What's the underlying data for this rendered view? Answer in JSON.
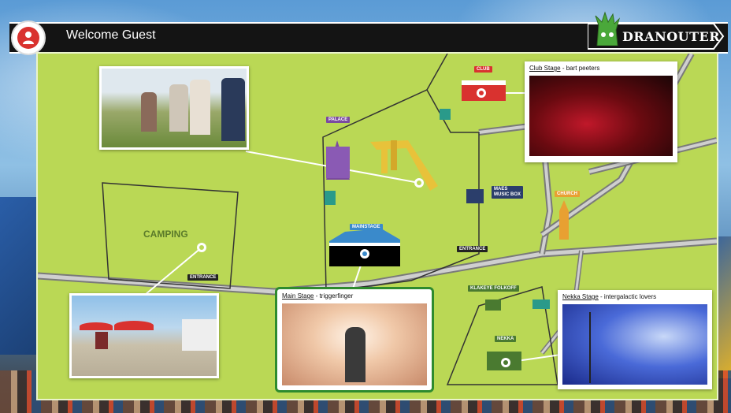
{
  "header": {
    "welcome": "Welcome Guest",
    "logo": "DRANOUTER"
  },
  "icons": {
    "user": "user-icon",
    "logo_mascot": "mascot-icon"
  },
  "colors": {
    "map_green": "#bad855",
    "road_gray": "#808080",
    "accent_red": "#d9322f",
    "highlight_green": "#2e8b2e"
  },
  "map": {
    "labels": {
      "camping": "CAMPING",
      "entrance_camping": "ENTRANCE",
      "entrance_main": "ENTRANCE",
      "palace": "PALACE",
      "club": "CLUB",
      "mainstage": "MAINSTAGE",
      "maes": "MAES\nMUSIC BOX",
      "church": "CHURCH",
      "klakeye": "KLAKEYE FOLKOFF",
      "nekka": "NEKKA"
    }
  },
  "popups": {
    "club": {
      "stage": "Club Stage",
      "artist": " - bart peeters"
    },
    "main": {
      "stage": "Main Stage",
      "artist": " - triggerfinger"
    },
    "nekka": {
      "stage": "Nekka Stage",
      "artist": " - intergalactic lovers"
    }
  }
}
